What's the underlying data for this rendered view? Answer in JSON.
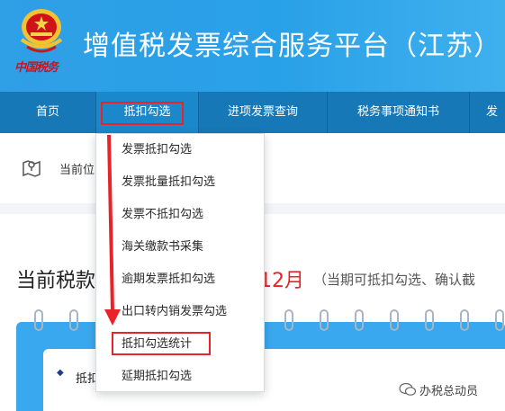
{
  "header": {
    "title": "增值税发票综合服务平台（江苏）",
    "emblem_text": "中国税务"
  },
  "nav": {
    "items": [
      {
        "label": "首页"
      },
      {
        "label": "抵扣勾选"
      },
      {
        "label": "进项发票查询"
      },
      {
        "label": "税务事项通知书"
      },
      {
        "label": "发"
      }
    ],
    "active": "抵扣勾选"
  },
  "breadcrumb": {
    "label": "当前位"
  },
  "period": {
    "prefix": "当前税款",
    "month": "12月",
    "note": "（当期可抵扣勾选、确认截"
  },
  "card": {
    "label": "抵扣"
  },
  "dropdown": {
    "items": [
      {
        "label": "发票抵扣勾选"
      },
      {
        "label": "发票批量抵扣勾选"
      },
      {
        "label": "发票不抵扣勾选"
      },
      {
        "label": "海关缴款书采集"
      },
      {
        "label": "逾期发票抵扣勾选"
      },
      {
        "label": "出口转内销发票勾选"
      },
      {
        "label": "抵扣勾选统计"
      },
      {
        "label": "延期抵扣勾选"
      }
    ],
    "highlighted": "抵扣勾选统计"
  },
  "watermark": {
    "text": "办税总动员"
  },
  "colors": {
    "header_blue": "#2f9fe6",
    "nav_blue": "#1778b8",
    "highlight_red": "#e8242a",
    "accent_red": "#d0121b"
  }
}
